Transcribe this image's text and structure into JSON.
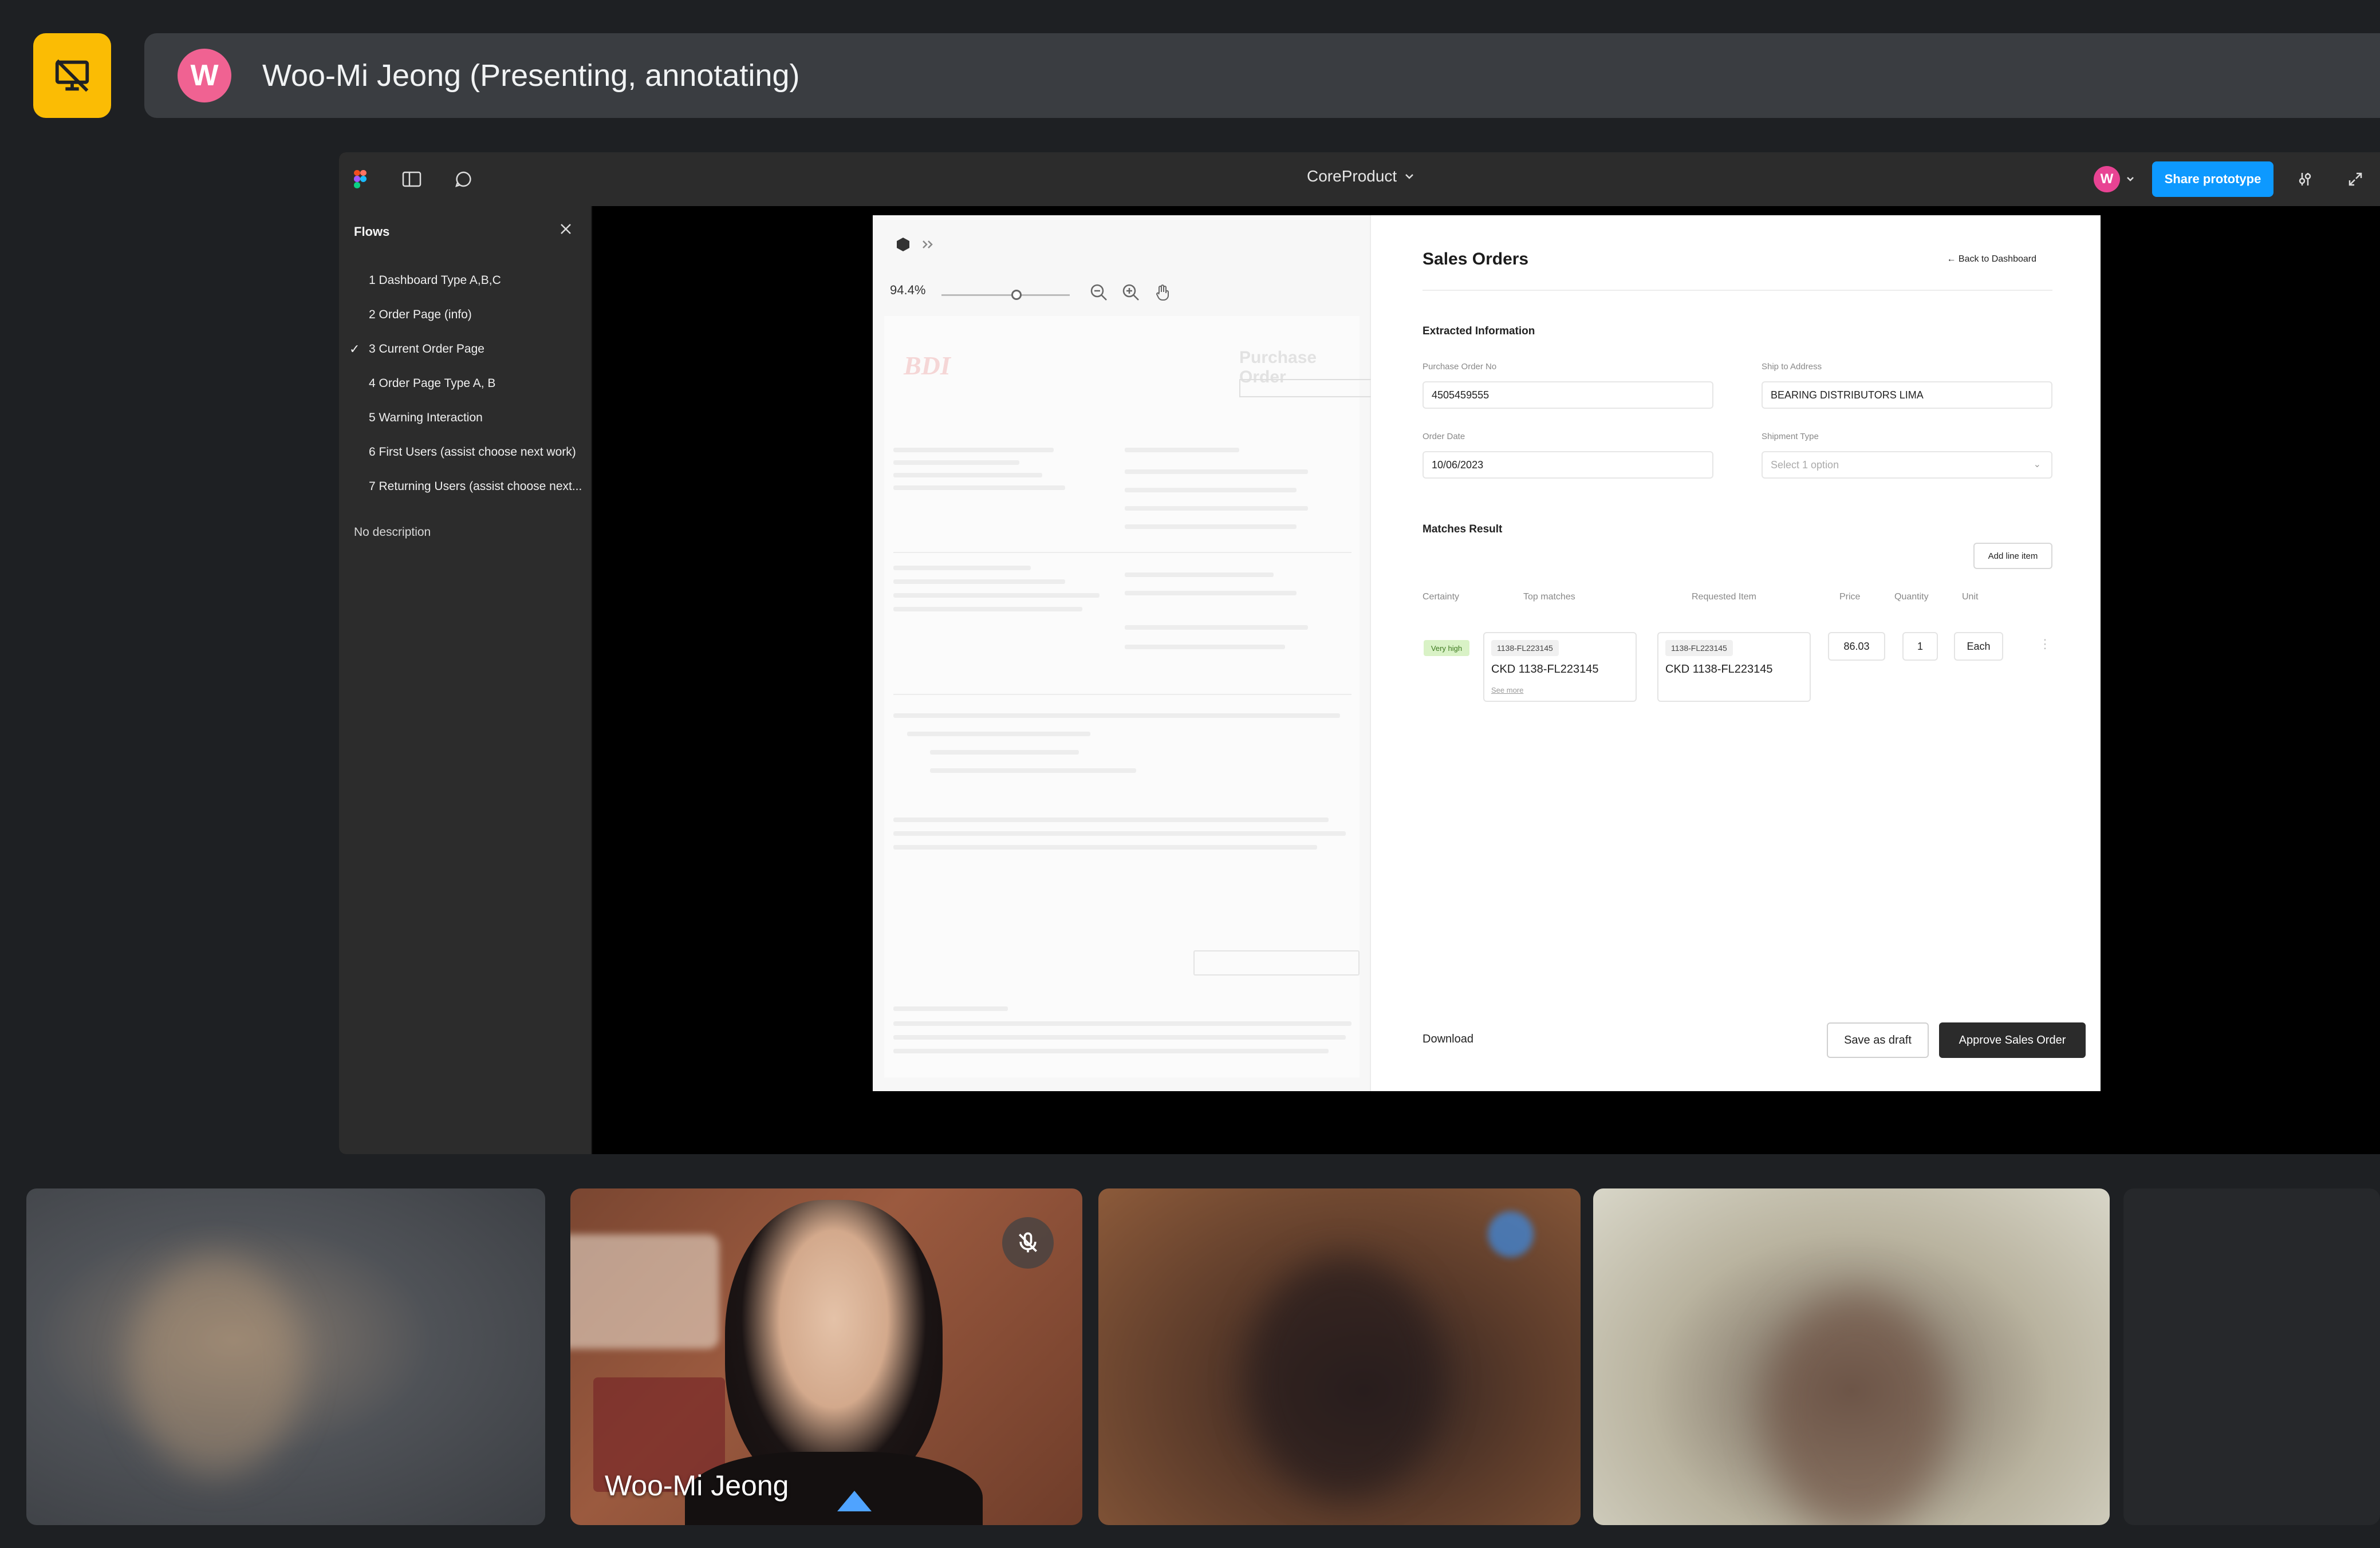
{
  "meet": {
    "presenter_initial": "W",
    "presenter_status": "Woo-Mi Jeong (Presenting, annotating)",
    "accent_color": "#fbbc04"
  },
  "figma": {
    "project_title": "CoreProduct",
    "user_initial": "W",
    "share_label": "Share prototype",
    "sidebar": {
      "heading": "Flows",
      "items": [
        "1 Dashboard Type A,B,C",
        "2 Order Page (info)",
        "3 Current Order Page",
        "4 Order Page Type A, B",
        "5 Warning Interaction",
        "6 First Users (assist choose next work)",
        "7 Returning Users (assist choose next..."
      ],
      "selected_index": 2,
      "description": "No description"
    }
  },
  "prototype": {
    "zoom": "94.4%",
    "document": {
      "logo": "BDI",
      "title": "Purchase Order"
    },
    "form": {
      "title": "Sales Orders",
      "back_link": "← Back to Dashboard",
      "extracted_heading": "Extracted Information",
      "po_label": "Purchase Order No",
      "po_value": "4505459555",
      "ship_label": "Ship to Address",
      "ship_value": "BEARING DISTRIBUTORS LIMA",
      "date_label": "Order Date",
      "date_value": "10/06/2023",
      "shipment_label": "Shipment Type",
      "shipment_placeholder": "Select 1 option",
      "matches_heading": "Matches Result",
      "add_line_label": "Add line item",
      "columns": [
        "Certainty",
        "Top matches",
        "Requested Item",
        "Price",
        "Quantity",
        "Unit"
      ],
      "row": {
        "certainty": "Very high",
        "top_match_code": "1138-FL223145",
        "top_match_text": "CKD 1138-FL223145",
        "see_more": "See more",
        "requested_code": "1138-FL223145",
        "requested_text": "CKD 1138-FL223145",
        "price": "86.03",
        "quantity": "1",
        "unit": "Each"
      },
      "download_label": "Download",
      "draft_label": "Save as draft",
      "approve_label": "Approve Sales Order"
    }
  },
  "participants": [
    {
      "name": ""
    },
    {
      "name": "Woo-Mi Jeong",
      "muted": true
    },
    {
      "name": ""
    },
    {
      "name": ""
    }
  ]
}
